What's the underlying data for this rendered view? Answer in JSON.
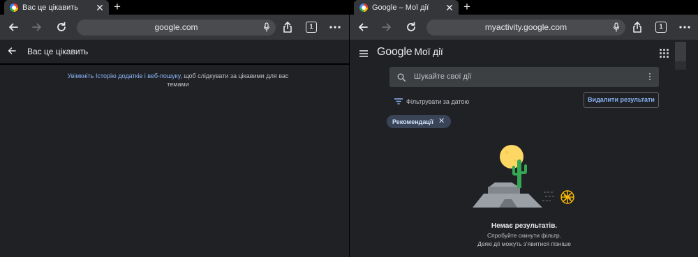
{
  "left": {
    "tab": {
      "title": "Вас це цікавить",
      "close": "✕"
    },
    "newtab": "+",
    "omnibox": {
      "url": "google.com"
    },
    "tabcount": "1",
    "header": {
      "title": "Вас це цікавить"
    },
    "message": {
      "link": "Увімкніть Історію додатків і веб-пошуку",
      "rest": ", щоб слідкувати за цікавими для вас темами"
    }
  },
  "right": {
    "tab": {
      "title": "Google – Мої дії",
      "close": "✕"
    },
    "newtab": "+",
    "omnibox": {
      "url": "myactivity.google.com"
    },
    "tabcount": "1",
    "logo": {
      "google": "Google",
      "product": "Мої дії"
    },
    "search": {
      "placeholder": "Шукайте свої дії"
    },
    "filter": {
      "label": "Фільтрувати за датою"
    },
    "delete_button": "Видалити результати",
    "chip": {
      "label": "Рекомендації",
      "close": "✕"
    },
    "empty": {
      "title": "Немає результатів.",
      "line1": "Спробуйте скинути фільтр.",
      "line2": "Деякі дії можуть з’явитися пізніше"
    }
  },
  "colors": {
    "background": "#202124",
    "toolbar": "#35363a",
    "link": "#8ab4f8",
    "chip": "#394457",
    "cactus": "#34a853",
    "moon": "#fdd663"
  }
}
